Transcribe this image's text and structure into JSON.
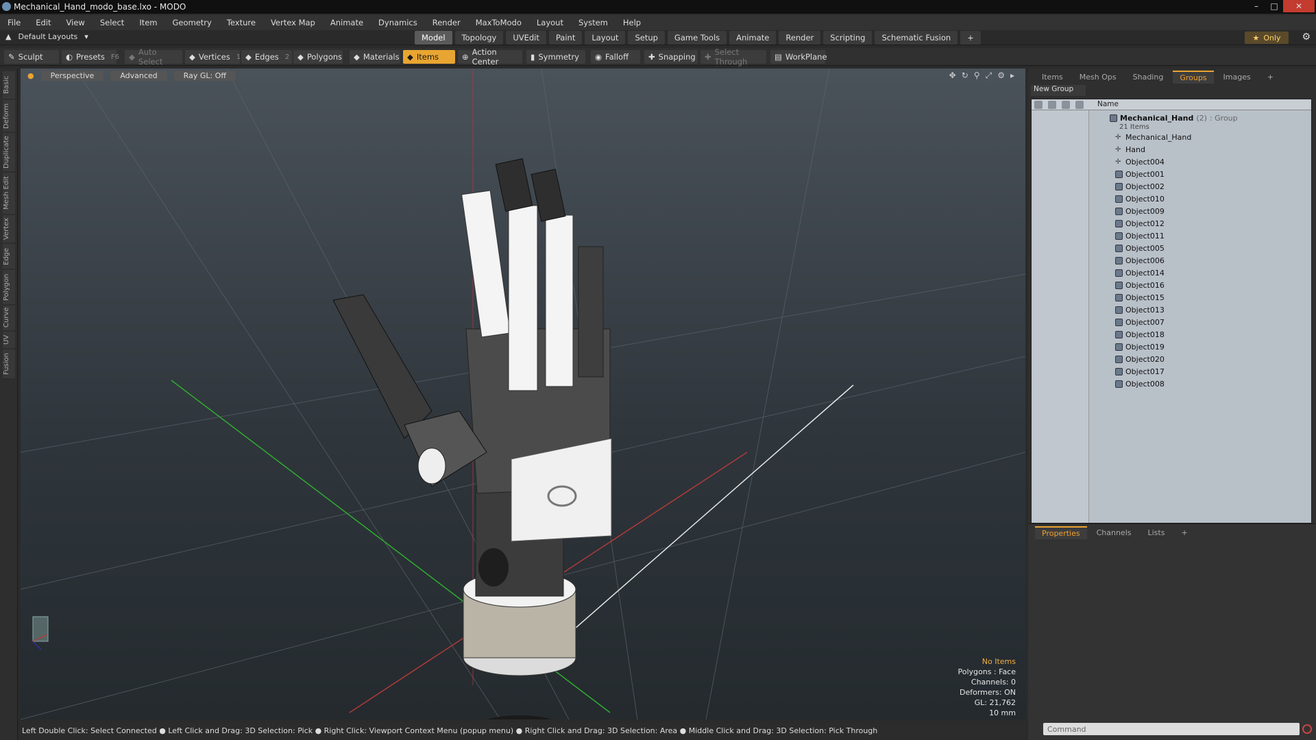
{
  "window": {
    "title": "Mechanical_Hand_modo_base.lxo - MODO",
    "controls": [
      "minimize",
      "maximize",
      "close"
    ]
  },
  "menu": [
    "File",
    "Edit",
    "View",
    "Select",
    "Item",
    "Geometry",
    "Texture",
    "Vertex Map",
    "Animate",
    "Dynamics",
    "Render",
    "MaxToModo",
    "Layout",
    "System",
    "Help"
  ],
  "layouts": {
    "label": "Default Layouts"
  },
  "modeTabs": [
    {
      "label": "Model",
      "active": true
    },
    {
      "label": "Topology"
    },
    {
      "label": "UVEdit"
    },
    {
      "label": "Paint"
    },
    {
      "label": "Layout"
    },
    {
      "label": "Setup"
    },
    {
      "label": "Game Tools"
    },
    {
      "label": "Animate"
    },
    {
      "label": "Render"
    },
    {
      "label": "Scripting"
    },
    {
      "label": "Schematic Fusion"
    }
  ],
  "only": {
    "label": "Only"
  },
  "toolbar": {
    "sculpt": "Sculpt",
    "presets": "Presets",
    "presets_hint": "F6",
    "autoselect": "Auto Select",
    "vertices": "Vertices",
    "vertices_hint": "1",
    "edges": "Edges",
    "edges_hint": "2",
    "polygons": "Polygons",
    "materials": "Materials",
    "items": "Items",
    "action_center": "Action Center",
    "symmetry": "Symmetry",
    "falloff": "Falloff",
    "snapping": "Snapping",
    "select_through": "Select Through",
    "workplane": "WorkPlane"
  },
  "leftTabs": [
    "Basic",
    "Deform",
    "Duplicate",
    "Mesh Edit",
    "Vertex",
    "Edge",
    "Polygon",
    "Curve",
    "UV",
    "Fusion"
  ],
  "viewport": {
    "mode": "Perspective",
    "advanced": "Advanced",
    "raygl": "Ray GL: Off",
    "info": {
      "items": "No Items",
      "polygons": "Polygons : Face",
      "channels": "Channels: 0",
      "deformers": "Deformers: ON",
      "gl": "GL: 21,762",
      "unit": "10 mm"
    }
  },
  "status": "Left Double Click: Select Connected ● Left Click and Drag: 3D Selection: Pick ● Right Click: Viewport Context Menu (popup menu) ● Right Click and Drag: 3D Selection: Area ● Middle Click and Drag: 3D Selection: Pick Through",
  "rightPanel": {
    "tabs": [
      "Items",
      "Mesh Ops",
      "Shading",
      "Groups",
      "Images"
    ],
    "activeTab": "Groups",
    "newGroup": "New Group",
    "columnName": "Name",
    "root": {
      "name": "Mechanical_Hand",
      "count": "(2)",
      "type": ": Group",
      "sub": "21 Items"
    },
    "items": [
      "Mechanical_Hand",
      "Hand",
      "Object004",
      "Object001",
      "Object002",
      "Object010",
      "Object009",
      "Object012",
      "Object011",
      "Object005",
      "Object006",
      "Object014",
      "Object016",
      "Object015",
      "Object013",
      "Object007",
      "Object018",
      "Object019",
      "Object020",
      "Object017",
      "Object008"
    ],
    "propTabs": [
      "Properties",
      "Channels",
      "Lists"
    ],
    "command_placeholder": "Command"
  },
  "colors": {
    "accent": "#e9a531",
    "viewportTop": "#4a525a",
    "viewportBottom": "#242a2e"
  }
}
